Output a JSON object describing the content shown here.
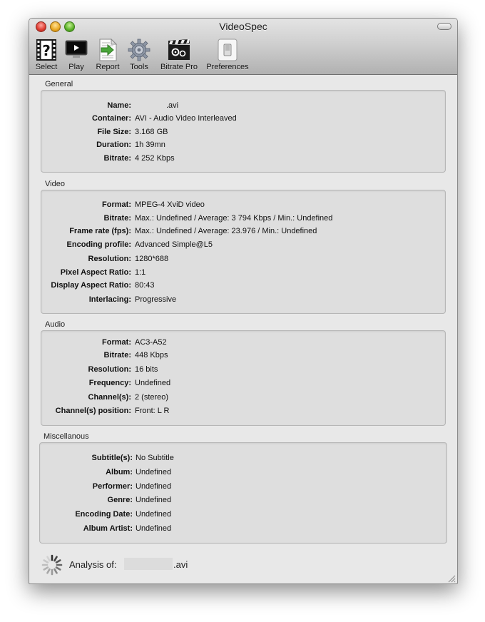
{
  "window": {
    "title": "VideoSpec"
  },
  "toolbar": [
    {
      "label": "Select",
      "icon": "filmstrip-question-icon"
    },
    {
      "label": "Play",
      "icon": "monitor-play-icon"
    },
    {
      "label": "Report",
      "icon": "document-arrow-icon"
    },
    {
      "label": "Tools",
      "icon": "gear-icon"
    },
    {
      "label": "Bitrate Pro",
      "icon": "clapper-gears-icon"
    },
    {
      "label": "Preferences",
      "icon": "switch-icon"
    }
  ],
  "general": {
    "title": "General",
    "rows": [
      {
        "label": "Name:",
        "value": ".avi"
      },
      {
        "label": "Container:",
        "value": "AVI - Audio Video Interleaved"
      },
      {
        "label": "File Size:",
        "value": "3.168 GB"
      },
      {
        "label": "Duration:",
        "value": "1h 39mn"
      },
      {
        "label": "Bitrate:",
        "value": "4 252 Kbps"
      }
    ]
  },
  "video": {
    "title": "Video",
    "rows": [
      {
        "label": "Format:",
        "value": "MPEG-4 XviD video"
      },
      {
        "label": "Bitrate:",
        "value": "Max.: Undefined / Average: 3 794 Kbps / Min.: Undefined"
      },
      {
        "label": "Frame rate (fps):",
        "value": "Max.: Undefined / Average: 23.976 / Min.: Undefined"
      },
      {
        "label": "Encoding profile:",
        "value": "Advanced Simple@L5"
      },
      {
        "label": "Resolution:",
        "value": "1280*688"
      },
      {
        "label": "Pixel Aspect Ratio:",
        "value": "1:1"
      },
      {
        "label": "Display Aspect Ratio:",
        "value": "80:43"
      },
      {
        "label": "Interlacing:",
        "value": "Progressive"
      }
    ]
  },
  "audio": {
    "title": "Audio",
    "rows": [
      {
        "label": "Format:",
        "value": "AC3-A52"
      },
      {
        "label": "Bitrate:",
        "value": "448 Kbps"
      },
      {
        "label": "Resolution:",
        "value": "16 bits"
      },
      {
        "label": "Frequency:",
        "value": "Undefined"
      },
      {
        "label": "Channel(s):",
        "value": "2 (stereo)"
      },
      {
        "label": "Channel(s) position:",
        "value": "Front: L R"
      }
    ]
  },
  "misc": {
    "title": "Miscellanous",
    "rows": [
      {
        "label": "Subtitle(s):",
        "value": "No Subtitle"
      },
      {
        "label": "Album:",
        "value": "Undefined"
      },
      {
        "label": "Performer:",
        "value": "Undefined"
      },
      {
        "label": "Genre:",
        "value": "Undefined"
      },
      {
        "label": "Encoding Date:",
        "value": "Undefined"
      },
      {
        "label": "Album Artist:",
        "value": "Undefined"
      }
    ]
  },
  "status": {
    "label": "Analysis of:",
    "file_ext": ".avi"
  }
}
